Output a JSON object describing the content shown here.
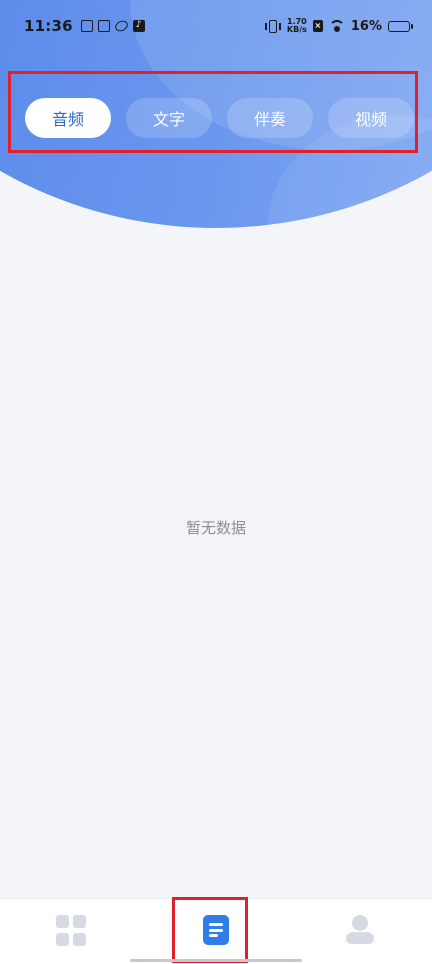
{
  "status_bar": {
    "time": "11:36",
    "net_speed_value": "1.70",
    "net_speed_unit": "KB/s",
    "battery_percent": "16%",
    "battery_level": 0.16,
    "battery_color": "#e53935"
  },
  "tabs": [
    {
      "label": "音频",
      "active": true
    },
    {
      "label": "文字",
      "active": false
    },
    {
      "label": "伴奏",
      "active": false
    },
    {
      "label": "视频",
      "active": false
    }
  ],
  "empty_state": {
    "text": "暂无数据"
  },
  "bottom_nav": [
    {
      "icon": "grid-icon",
      "active": false
    },
    {
      "icon": "document-list-icon",
      "active": true
    },
    {
      "icon": "user-icon",
      "active": false
    }
  ],
  "colors": {
    "accent": "#2f7de8",
    "header_gradient_start": "#4d7de6",
    "header_gradient_end": "#8fb2f5",
    "background": "#f3f5f9",
    "annotation_red": "#e0202a"
  }
}
